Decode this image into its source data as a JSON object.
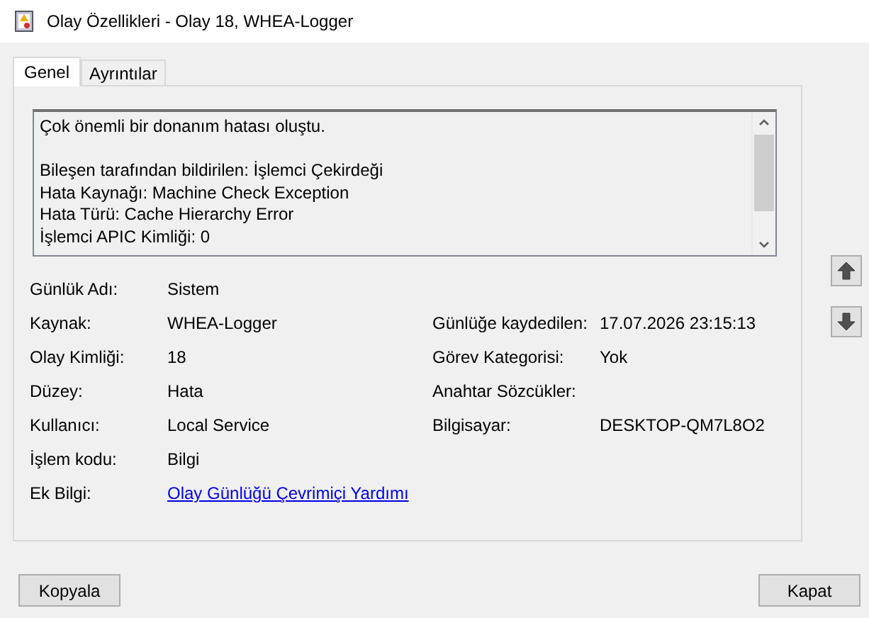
{
  "window": {
    "title": "Olay Özellikleri - Olay 18, WHEA-Logger"
  },
  "tabs": [
    {
      "label": "Genel",
      "selected": true
    },
    {
      "label": "Ayrıntılar",
      "selected": false
    }
  ],
  "description": {
    "paragraphs": [
      [
        "Çok önemli bir donanım hatası oluştu."
      ],
      [
        "Bileşen tarafından bildirilen: İşlemci Çekirdeği",
        "Hata Kaynağı: Machine Check Exception",
        "Hata Türü: Cache Hierarchy Error",
        "İşlemci APIC Kimliği: 0"
      ]
    ]
  },
  "fields": [
    {
      "label": "Günlük Adı:",
      "value": "Sistem"
    },
    {
      "label": "Kaynak:",
      "value": "WHEA-Logger",
      "right_label": "Günlüğe kaydedilen:",
      "right_value": "17.07.2026 23:15:13"
    },
    {
      "label": "Olay Kimliği:",
      "value": "18",
      "right_label": "Görev Kategorisi:",
      "right_value": "Yok"
    },
    {
      "label": "Düzey:",
      "value": "Hata",
      "right_label": "Anahtar Sözcükler:"
    },
    {
      "label": "Kullanıcı:",
      "value": "Local Service",
      "right_label": "Bilgisayar:",
      "right_value": "DESKTOP-QM7L8O2"
    },
    {
      "label": "İşlem kodu:",
      "value": "Bilgi"
    },
    {
      "label": "Ek Bilgi:",
      "value": "Olay Günlüğü Çevrimiçi Yardımı",
      "kind": "link"
    }
  ],
  "buttons": [
    {
      "label": "Kopyala"
    },
    {
      "label": "Kapat"
    }
  ]
}
